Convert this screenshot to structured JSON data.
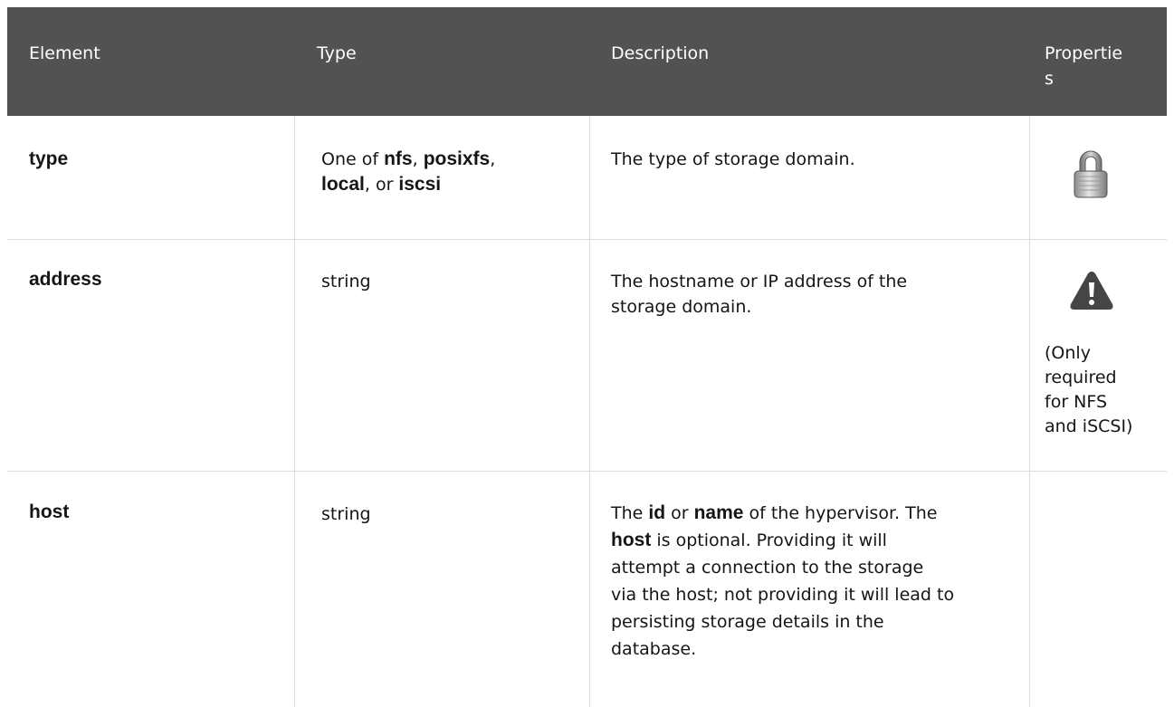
{
  "table": {
    "headers": {
      "element": "Element",
      "type": "Type",
      "description": "Description",
      "properties_line1": "Propertie",
      "properties_line2": "s"
    },
    "rows": [
      {
        "element": "type",
        "type_parts": [
          "One of ",
          "nfs",
          ", ",
          "posixfs",
          ",",
          "local",
          ", or ",
          "iscsi"
        ],
        "description": "The type of storage domain.",
        "properties_icon": "padlock-icon",
        "properties_note": ""
      },
      {
        "element": "address",
        "type": "string",
        "description_line1": "The hostname or IP address of the",
        "description_line2": "storage domain.",
        "properties_icon": "warning-icon",
        "properties_note_lines": [
          "(Only",
          "required",
          "for NFS",
          "and iSCSI)"
        ]
      },
      {
        "element": "host",
        "type": "string",
        "description_parts": {
          "l1a": "The ",
          "l1b": "id",
          "l1c": " or ",
          "l1d": "name",
          "l1e": " of the hypervisor. The",
          "l2a": "host",
          "l2b": " is optional. Providing it will",
          "l3": "attempt a connection to the storage",
          "l4": "via the host; not providing it will lead to",
          "l5": "persisting storage details in the",
          "l6": "database."
        }
      }
    ]
  },
  "colors": {
    "header_bg": "#525252",
    "header_text": "#ffffff",
    "grid": "#dddddd"
  }
}
